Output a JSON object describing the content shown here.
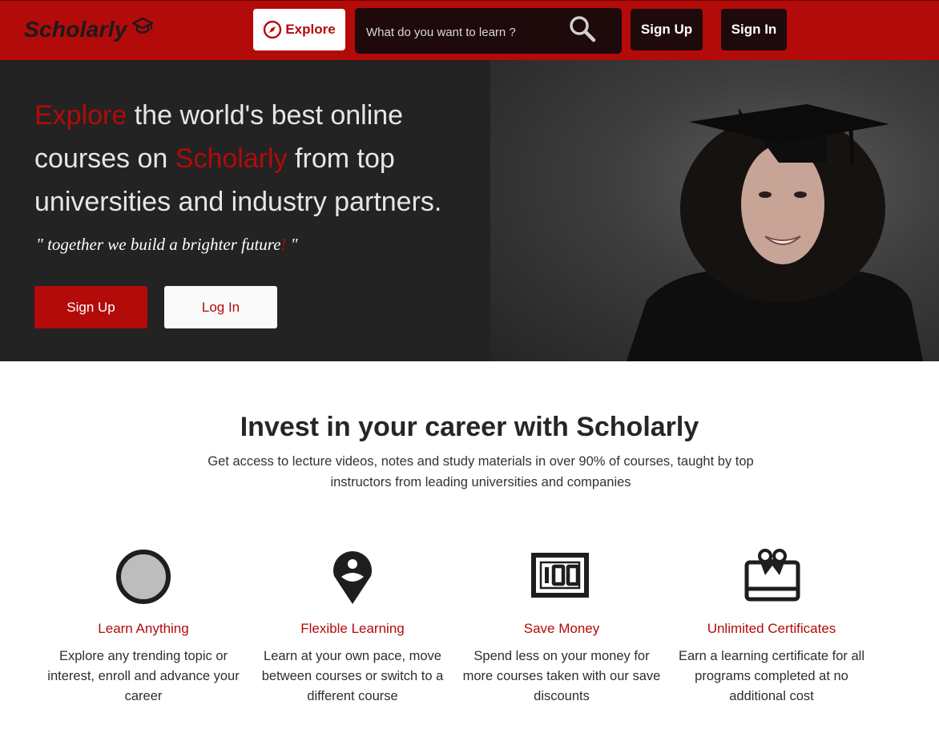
{
  "nav": {
    "brand": "Scholarly",
    "brand_icon": "graduation-cap-icon",
    "explore_label": "Explore",
    "explore_icon": "compass-icon",
    "search_placeholder": "What do you want to learn ?",
    "search_icon": "search-icon",
    "signup_label": "Sign Up",
    "signin_label": "Sign In"
  },
  "hero": {
    "headline_part1": "Explore",
    "headline_part2": " the world's best online courses on ",
    "headline_part3": "Scholarly",
    "headline_part4": " from top universities and industry partners.",
    "quote_part1": "\" together we build a brighter future",
    "quote_part2": "!",
    "quote_part3": " \"",
    "signup_label": "Sign Up",
    "login_label": "Log In"
  },
  "section": {
    "title": "Invest in your career with Scholarly",
    "subtitle": "Get access to lecture videos, notes and study materials in over 90% of courses, taught by top instructors from leading universities and companies"
  },
  "features": [
    {
      "icon": "circle-icon",
      "title": "Learn Anything",
      "desc": "Explore any trending topic or interest, enroll and advance your career"
    },
    {
      "icon": "map-pin-icon",
      "title": "Flexible Learning",
      "desc": "Learn at your own pace, move between courses or switch to a different course"
    },
    {
      "icon": "money-100-icon",
      "title": "Save Money",
      "desc": "Spend less on your money for more courses taken with our save discounts"
    },
    {
      "icon": "gift-card-icon",
      "title": "Unlimited Certificates",
      "desc": "Earn a learning certificate for all programs completed at no additional cost"
    }
  ],
  "colors": {
    "brand_red": "#b30a0a",
    "nav_dark": "#1e0a0a",
    "hero_bg": "#232323"
  }
}
